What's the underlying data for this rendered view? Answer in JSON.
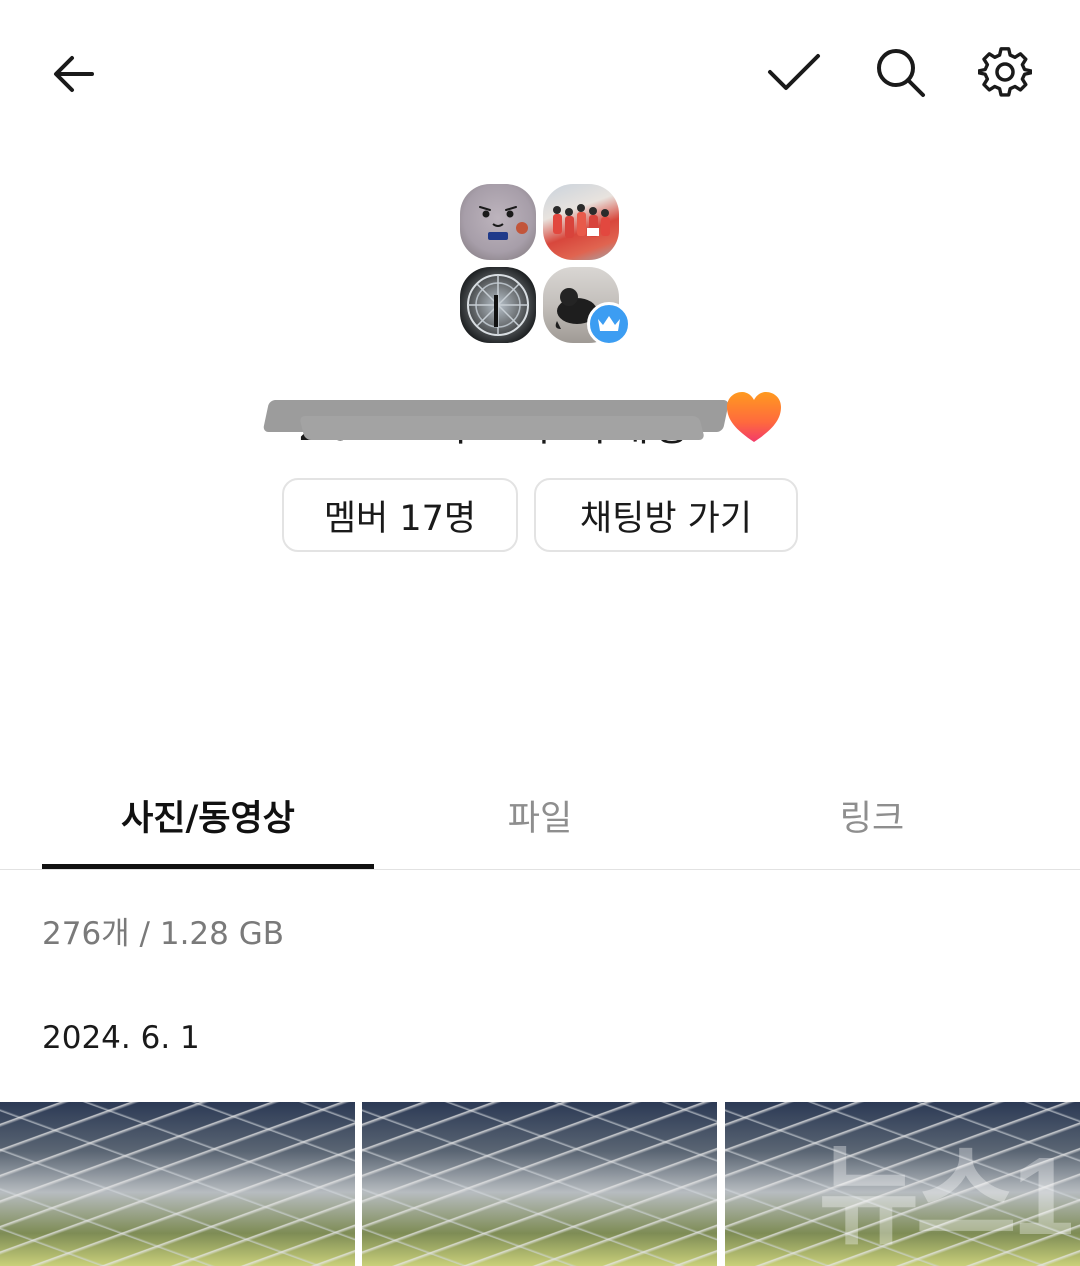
{
  "header": {
    "back_icon": "arrow-left-icon",
    "check_icon": "check-icon",
    "search_icon": "search-icon",
    "settings_icon": "gear-icon"
  },
  "room": {
    "title": "2024 아그의 나래방",
    "title_emoji": "orange-heart-icon",
    "avatars": [
      "avatar-1",
      "avatar-2",
      "avatar-3",
      "avatar-4"
    ],
    "owner_badge_icon": "crown-icon",
    "badge_color": "#3c9df2"
  },
  "actions": {
    "members_label": "멤버 17명",
    "goto_chat_label": "채팅방 가기"
  },
  "tabs": [
    {
      "label": "사진/동영상",
      "active": true
    },
    {
      "label": "파일",
      "active": false
    },
    {
      "label": "링크",
      "active": false
    }
  ],
  "gallery": {
    "summary": "276개 / 1.28 GB",
    "groups": [
      {
        "date": "2024. 6. 1",
        "thumbnails": [
          "photo-1",
          "photo-2",
          "photo-3"
        ]
      }
    ],
    "watermark": "뉴스1"
  }
}
